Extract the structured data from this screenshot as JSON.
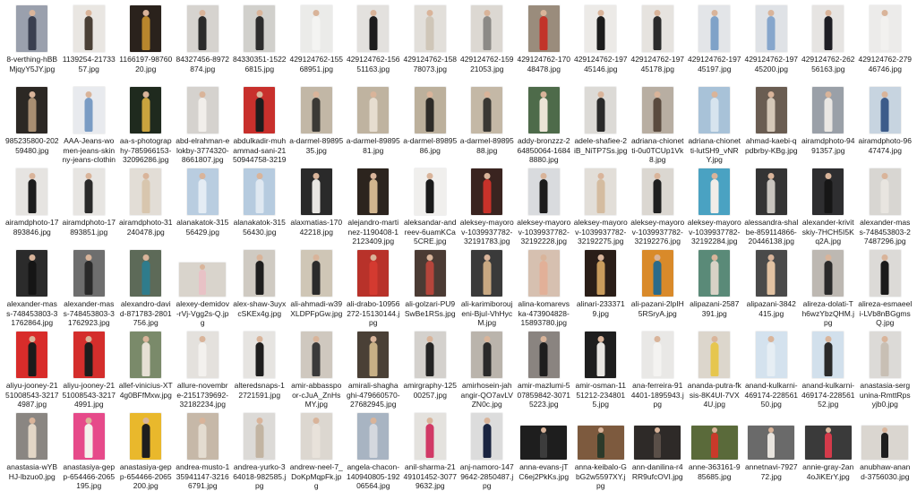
{
  "icons": {
    "image_file": "image-thumbnail-icon"
  },
  "files": [
    {
      "name": "8-verthing-hBBMjqyY5JY.jpg",
      "bg": "#9aa0ad",
      "fg": "#3a3f50"
    },
    {
      "name": "1139254-2173357.jpg",
      "bg": "#e9e6e2",
      "fg": "#4a4036"
    },
    {
      "name": "1166197-9876020.jpg",
      "bg": "#2a221c",
      "fg": "#b8862d"
    },
    {
      "name": "84327456-8972874.jpg",
      "bg": "#d6d3cf",
      "fg": "#2b2b2b"
    },
    {
      "name": "84330351-15226815.jpg",
      "bg": "#d1d0cc",
      "fg": "#2d2d2d"
    },
    {
      "name": "429124762-15568951.jpg",
      "bg": "#ebebe9",
      "fg": "#f4f4f2"
    },
    {
      "name": "429124762-15651163.jpg",
      "bg": "#e3e1de",
      "fg": "#1d1d1d"
    },
    {
      "name": "429124762-15878073.jpg",
      "bg": "#e2dfda",
      "fg": "#cfc6b8"
    },
    {
      "name": "429124762-15921053.jpg",
      "bg": "#dcd8d2",
      "fg": "#8c8a86"
    },
    {
      "name": "429124762-17048478.jpg",
      "bg": "#9a8c7c",
      "fg": "#c2342a"
    },
    {
      "name": "429124762-19745146.jpg",
      "bg": "#eceae7",
      "fg": "#1c1c1c"
    },
    {
      "name": "429124762-19745178.jpg",
      "bg": "#e6e3df",
      "fg": "#2b2b2b"
    },
    {
      "name": "429124762-19745197.jpg",
      "bg": "#e3e5e8",
      "fg": "#7fa2c8"
    },
    {
      "name": "429124762-19745200.jpg",
      "bg": "#dfe2e6",
      "fg": "#86a6cc"
    },
    {
      "name": "429124762-26256163.jpg",
      "bg": "#e6e4e2",
      "fg": "#1e1e24"
    },
    {
      "name": "429124762-27946746.jpg",
      "bg": "#ecebea",
      "fg": "#f2f1ef"
    },
    {
      "name": "985235800-20259480.jpg",
      "bg": "#2c2824",
      "fg": "#a88e72"
    },
    {
      "name": "AAA-Jeans-women-jeans-skinny-jeans-clothing-denim-jean...",
      "bg": "#e8eaee",
      "fg": "#7a9cc4"
    },
    {
      "name": "aa-s-photography-785966153-32096286.jpg",
      "bg": "#1f2a1e",
      "fg": "#c9a33e"
    },
    {
      "name": "abd-elrahman-elokby-3774320-8661807.jpg",
      "bg": "#d5d2ce",
      "fg": "#f1eeea"
    },
    {
      "name": "abdulkadir-muhammad-sani-2150944758-32191009.jpg",
      "bg": "#c8302c",
      "fg": "#1d1d1d"
    },
    {
      "name": "a-darmel-8989535.jpg",
      "bg": "#c2b7a6",
      "fg": "#3c3a36"
    },
    {
      "name": "a-darmel-8989581.jpg",
      "bg": "#bfb3a0",
      "fg": "#e6ddd0"
    },
    {
      "name": "a-darmel-8989586.jpg",
      "bg": "#bcb09c",
      "fg": "#2e2c28"
    },
    {
      "name": "a-darmel-8989588.jpg",
      "bg": "#c4b8a6",
      "fg": "#3a3834"
    },
    {
      "name": "addy-bronzzz-264850064-16848880.jpg",
      "bg": "#4e6b4a",
      "fg": "#ece4d6"
    },
    {
      "name": "adele-shafiee-2iB_NiTP7Ss.jpg",
      "bg": "#dcdad6",
      "fg": "#2a2a2a"
    },
    {
      "name": "adriana-chionetti-0u0TCUp1Vk8.jpg",
      "bg": "#b8aea2",
      "fg": "#5a4a3e"
    },
    {
      "name": "adriana-chionetti-lutSH9_vNRY.jpg",
      "bg": "#a8c2d8",
      "fg": "#d7e4ee"
    },
    {
      "name": "ahmad-kaebi-qpdbrby-KBg.jpg",
      "bg": "#6a5d52",
      "fg": "#d5c8b8"
    },
    {
      "name": "airamdphoto-9491357.jpg",
      "bg": "#9aa0a8",
      "fg": "#eae7e3"
    },
    {
      "name": "airamdphoto-9647474.jpg",
      "bg": "#c7d4e0",
      "fg": "#3c5b8a"
    },
    {
      "name": "airamdphoto-17893846.jpg",
      "bg": "#e6e4e1",
      "fg": "#1d1d1d"
    },
    {
      "name": "airamdphoto-17893851.jpg",
      "bg": "#e7e5e2",
      "fg": "#2a2a2a"
    },
    {
      "name": "airamdphoto-31240478.jpg",
      "bg": "#e2ddd6",
      "fg": "#d8c6ae"
    },
    {
      "name": "alanakatok-31556429.jpg",
      "bg": "#b9cde0",
      "fg": "#e4ecf4"
    },
    {
      "name": "alanakatok-31556430.jpg",
      "bg": "#b6cbdf",
      "fg": "#dfe8f1"
    },
    {
      "name": "alaxmatias-17042218.jpg",
      "bg": "#2a2a2a",
      "fg": "#e8e6e2"
    },
    {
      "name": "alejandro-martinez-1190408-12123409.jpg",
      "bg": "#2c241e",
      "fg": "#d1b58e"
    },
    {
      "name": "aleksandar-andreev-6uamKCa5CRE.jpg",
      "bg": "#f0efed",
      "fg": "#1a1a1a"
    },
    {
      "name": "aleksey-mayorov-1039937782-32191783.jpg",
      "bg": "#3a2420",
      "fg": "#c8322a"
    },
    {
      "name": "aleksey-mayorov-1039937782-32192228.jpg",
      "bg": "#d9dbde",
      "fg": "#1c1c1c"
    },
    {
      "name": "aleksey-mayorov-1039937782-32192275.jpg",
      "bg": "#e2ded8",
      "fg": "#d4bca0"
    },
    {
      "name": "aleksey-mayorov-1039937782-32192276.jpg",
      "bg": "#dbd7d1",
      "fg": "#1f1f1f"
    },
    {
      "name": "aleksey-mayorov-1039937782-32192284.jpg",
      "bg": "#4aa2c2",
      "fg": "#f1ede8"
    },
    {
      "name": "alessandra-shalbe-859114866-20446138.jpg",
      "bg": "#343434",
      "fg": "#c8c4be"
    },
    {
      "name": "alexander-krivitskiy-7HCH5I5Kq2A.jpg",
      "bg": "#2e2e30",
      "fg": "#161616"
    },
    {
      "name": "alexander-mass-748453803-27487296.jpg",
      "bg": "#d8d6d2",
      "fg": "#e8e5e0"
    },
    {
      "name": "alexander-mass-748453803-31762864.jpg",
      "bg": "#2b2b2b",
      "fg": "#151515"
    },
    {
      "name": "alexander-mass-748453803-31762923.jpg",
      "bg": "#6e6e6e",
      "fg": "#2a2a2a"
    },
    {
      "name": "alexandro-david-871783-2801756.jpg",
      "bg": "#5d6a58",
      "fg": "#2f7c8c"
    },
    {
      "name": "alexey-demidov-rVj-Vgg2s-Q.jpg",
      "bg": "#d9d4cc",
      "fg": "#e8c2c6",
      "wide": true
    },
    {
      "name": "alex-shaw-3uyxcSKEx4g.jpg",
      "bg": "#cfcac2",
      "fg": "#1e1e1e"
    },
    {
      "name": "ali-ahmadi-w39XLDPFpGw.jpg",
      "bg": "#cfc6b6",
      "fg": "#2b2b2b"
    },
    {
      "name": "ali-drabo-10956272-15130144.jpg",
      "bg": "#b8322a",
      "fg": "#d43a30"
    },
    {
      "name": "ali-golzari-PU9SwBe1RSs.jpg",
      "bg": "#4b3b34",
      "fg": "#b5453b"
    },
    {
      "name": "ali-karimiboroujeni-BjuI-VhHycM.jpg",
      "bg": "#3a3a3a",
      "fg": "#c8a882"
    },
    {
      "name": "alina-komarevska-473904828-15893780.jpg",
      "bg": "#d6c0b0",
      "fg": "#e2b098"
    },
    {
      "name": "alinari-2333719.jpg",
      "bg": "#2a1e18",
      "fg": "#c99c5c"
    },
    {
      "name": "ali-pazani-2lpIH5RSryA.jpg",
      "bg": "#d98a2a",
      "fg": "#2b6b8a"
    },
    {
      "name": "alipazani-2587391.jpg",
      "bg": "#5a8a78",
      "fg": "#d8d2c6"
    },
    {
      "name": "alipazani-3842415.jpg",
      "bg": "#4a4a4a",
      "fg": "#e2c2a2"
    },
    {
      "name": "alireza-dolati-Th6wzYbzQHM.jpg",
      "bg": "#bdb8b2",
      "fg": "#2a2a2a"
    },
    {
      "name": "alireza-esmaeeli-LVb8nBGgmsQ.jpg",
      "bg": "#dcdad7",
      "fg": "#1a1a1a"
    },
    {
      "name": "aliyu-jooney-2151008543-32174987.jpg",
      "bg": "#d82c2a",
      "fg": "#1b1b1b"
    },
    {
      "name": "aliyu-jooney-2151008543-32174991.jpg",
      "bg": "#d42e2c",
      "fg": "#1d1d1d"
    },
    {
      "name": "allef-vinicius-XT4g0BFfMxw.jpg",
      "bg": "#7a8a6a",
      "fg": "#e6e0d4"
    },
    {
      "name": "allure-novembre-2151739692-32182234.jpg",
      "bg": "#e4e1dd",
      "fg": "#f3f1ee"
    },
    {
      "name": "alteredsnaps-12721591.jpg",
      "bg": "#e6e4e1",
      "fg": "#1e1e1e"
    },
    {
      "name": "amir-abbasspoor-cJuA_ZnHsMY.jpg",
      "bg": "#cfc8bf",
      "fg": "#3a3a3a"
    },
    {
      "name": "amirali-shaghaghi-479660570-27682945.jpg",
      "bg": "#4a4036",
      "fg": "#c8b086"
    },
    {
      "name": "amirgraphy-12500257.jpg",
      "bg": "#d4d1cd",
      "fg": "#242424"
    },
    {
      "name": "amirhosein-jahangir-QO7avLVZN0c.jpg",
      "bg": "#bab4ac",
      "fg": "#2a2a2a"
    },
    {
      "name": "amir-mazlumi-507859842-30715223.jpg",
      "bg": "#8a8480",
      "fg": "#1e1e1e"
    },
    {
      "name": "amir-osman-1151212-2348015.jpg",
      "bg": "#1e1e1e",
      "fg": "#e8e6e2"
    },
    {
      "name": "ana-ferreira-914401-1895943.jpg",
      "bg": "#e9e8e6",
      "fg": "#f4f3f1"
    },
    {
      "name": "ananda-putra-fksis-8K4UI-7VX4U.jpg",
      "bg": "#dcd6cc",
      "fg": "#e6c64e"
    },
    {
      "name": "anand-kulkarni-469174-22856150.jpg",
      "bg": "#d4e2ee",
      "fg": "#e6eef4"
    },
    {
      "name": "anand-kulkarni-469174-22856152.jpg",
      "bg": "#d2e0ec",
      "fg": "#2a2a2a"
    },
    {
      "name": "anastasia-sergunina-RmttRpsyjb0.jpg",
      "bg": "#dcdad7",
      "fg": "#c8bfb4"
    },
    {
      "name": "anastasia-wYBHJ-lbzuo0.jpg",
      "bg": "#8a8682",
      "fg": "#e2d6c6"
    },
    {
      "name": "anastasiya-gepp-654466-2065195.jpg",
      "bg": "#e64a8a",
      "fg": "#f4f1ec"
    },
    {
      "name": "anastasiya-gepp-654466-2065200.jpg",
      "bg": "#e9b82c",
      "fg": "#1e1e1e"
    },
    {
      "name": "andrea-musto-135941147-32166791.jpg",
      "bg": "#c6b8a8",
      "fg": "#e4dcd0"
    },
    {
      "name": "andrea-yurko-364018-982585.jpg",
      "bg": "#dcdad7",
      "fg": "#c2b4a2"
    },
    {
      "name": "andrew-neel-7_DoKpMqpFk.jpg",
      "bg": "#dcd7d0",
      "fg": "#e8e2da"
    },
    {
      "name": "angela-chacon-140940805-19206564.jpg",
      "bg": "#a8b4c2",
      "fg": "#d4d8de"
    },
    {
      "name": "anil-sharma-2149101452-30779632.jpg",
      "bg": "#e4e2de",
      "fg": "#d13a66"
    },
    {
      "name": "anj-namoro-1479642-2850487.jpg",
      "bg": "#dcdcdc",
      "fg": "#1a2440"
    },
    {
      "name": "anna-evans-jTC6ej2PkKs.jpg",
      "bg": "#1e1e1e",
      "fg": "#3c3c3c",
      "wide": true
    },
    {
      "name": "anna-keibalo-GbG2w5597XY.jpg",
      "bg": "#7d5a3e",
      "fg": "#2c3a2a",
      "wide": true
    },
    {
      "name": "ann-danilina-r4RR9ufcOVI.jpg",
      "bg": "#2e2a28",
      "fg": "#5a4f48",
      "wide": true
    },
    {
      "name": "anne-363161-985685.jpg",
      "bg": "#5a6a3a",
      "fg": "#c83a2a",
      "wide": true
    },
    {
      "name": "annetnavi-792772.jpg",
      "bg": "#6a6a6a",
      "fg": "#e8e4de",
      "wide": true
    },
    {
      "name": "annie-gray-2an4oJiKErY.jpg",
      "bg": "#3a3a3a",
      "fg": "#d43a4a",
      "wide": true
    },
    {
      "name": "anubhaw-anand-3756030.jpg",
      "bg": "#dad6d0",
      "fg": "#1e1e1e",
      "wide": true
    }
  ]
}
